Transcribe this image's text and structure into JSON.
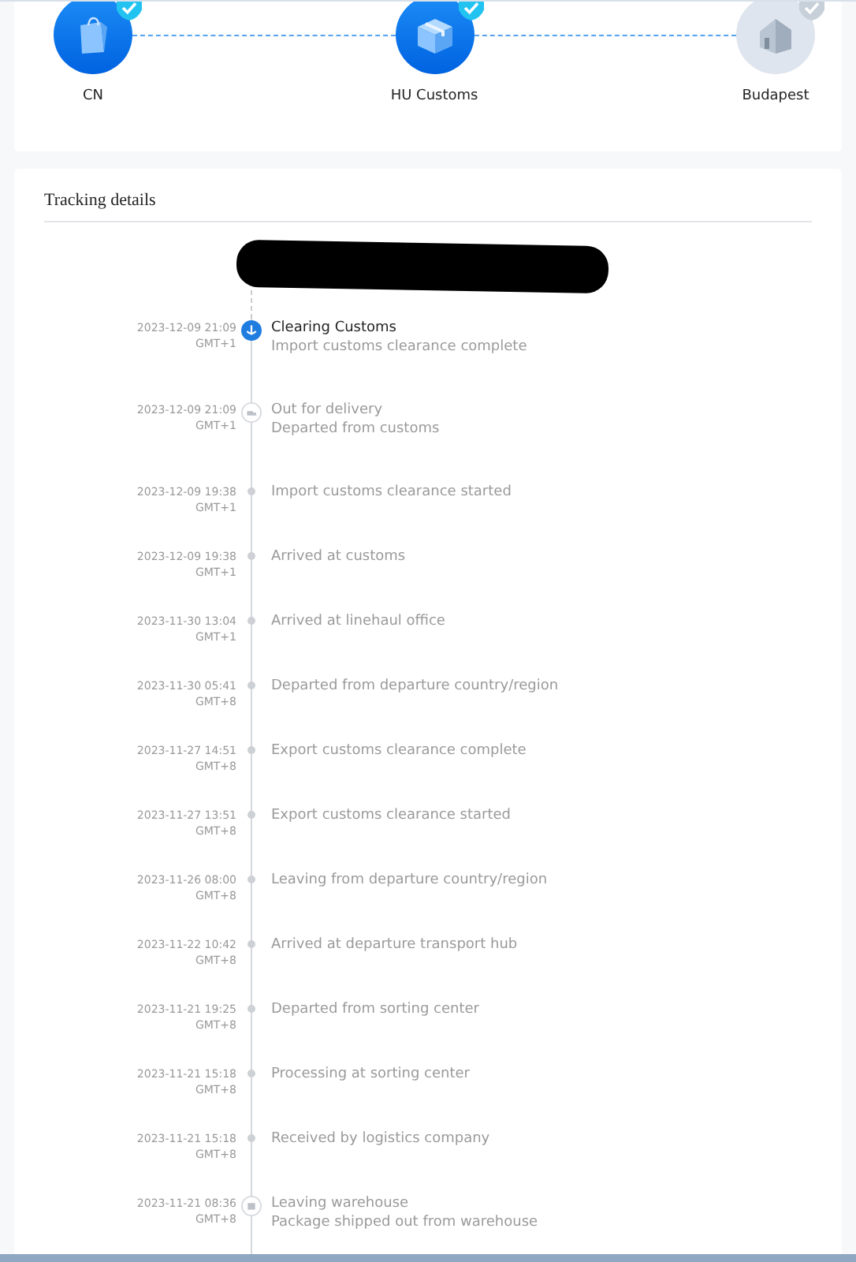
{
  "stages": [
    {
      "label": "CN",
      "kind": "bag",
      "done": true
    },
    {
      "label": "HU Customs",
      "kind": "box",
      "done": true
    },
    {
      "label": "Budapest",
      "kind": "house",
      "done": false
    }
  ],
  "tracking": {
    "title": "Tracking details",
    "events": [
      {
        "date": "2023-12-09 21:09",
        "zone": "GMT+1",
        "kind": "current",
        "title": "Clearing Customs",
        "detail": "Import customs clearance complete"
      },
      {
        "date": "2023-12-09 21:09",
        "zone": "GMT+1",
        "kind": "truck",
        "title": "Out for delivery",
        "detail": "Departed from customs"
      },
      {
        "date": "2023-12-09 19:38",
        "zone": "GMT+1",
        "kind": "dot",
        "title": "Import customs clearance started"
      },
      {
        "date": "2023-12-09 19:38",
        "zone": "GMT+1",
        "kind": "dot",
        "title": "Arrived at customs"
      },
      {
        "date": "2023-11-30 13:04",
        "zone": "GMT+1",
        "kind": "dot",
        "title": "Arrived at linehaul office"
      },
      {
        "date": "2023-11-30 05:41",
        "zone": "GMT+8",
        "kind": "dot",
        "title": "Departed from departure country/region"
      },
      {
        "date": "2023-11-27 14:51",
        "zone": "GMT+8",
        "kind": "dot",
        "title": "Export customs clearance complete"
      },
      {
        "date": "2023-11-27 13:51",
        "zone": "GMT+8",
        "kind": "dot",
        "title": "Export customs clearance started"
      },
      {
        "date": "2023-11-26 08:00",
        "zone": "GMT+8",
        "kind": "dot",
        "title": "Leaving from departure country/region"
      },
      {
        "date": "2023-11-22 10:42",
        "zone": "GMT+8",
        "kind": "dot",
        "title": "Arrived at departure transport hub"
      },
      {
        "date": "2023-11-21 19:25",
        "zone": "GMT+8",
        "kind": "dot",
        "title": "Departed from sorting center"
      },
      {
        "date": "2023-11-21 15:18",
        "zone": "GMT+8",
        "kind": "dot",
        "title": "Processing at sorting center"
      },
      {
        "date": "2023-11-21 15:18",
        "zone": "GMT+8",
        "kind": "dot",
        "title": "Received by logistics company"
      },
      {
        "date": "2023-11-21 08:36",
        "zone": "GMT+8",
        "kind": "package",
        "title": "Leaving warehouse",
        "detail": "Package shipped out from warehouse"
      }
    ]
  }
}
